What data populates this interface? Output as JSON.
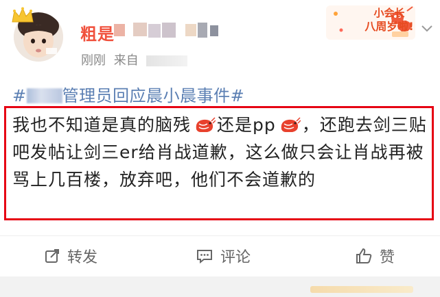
{
  "post": {
    "username": "粗是",
    "time": "刚刚",
    "source_label": "来自",
    "topic_prefix": "#",
    "topic_suffix": "管理员回应晨小晨事件#",
    "badge_line1": "小会长",
    "badge_line2": "八周岁啦!",
    "text": {
      "seg1": "我也不知道是真的脑残",
      "seg2": "还是pp",
      "seg3": "，还跑去剑三贴吧发帖让剑三er给肖战道歉，这么做只会让肖战再被骂上几百楼，放弃吧，他们不会道歉的"
    },
    "emoji_name": "shrimp-emoji"
  },
  "actions": {
    "repost": "转发",
    "comment": "评论",
    "like": "赞"
  },
  "colors": {
    "highlight_border": "#e60012",
    "topic": "#5b7fb3",
    "username": "#f0503c"
  }
}
